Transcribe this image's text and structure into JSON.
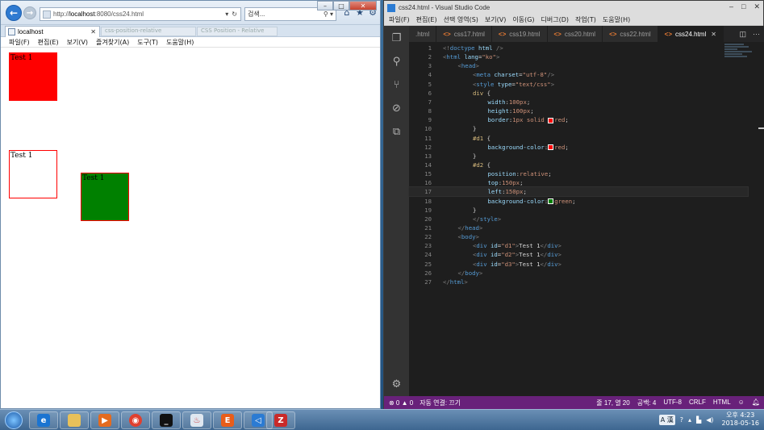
{
  "ie": {
    "address": {
      "prefix": "http://",
      "host": "localhost",
      "path": ":8080/css24.html"
    },
    "search_placeholder": "검색...",
    "tab_title": "localhost",
    "bg_tab_1": "css-position-relative",
    "bg_tab_2": "CSS Position - Relative",
    "menu": [
      "파일(F)",
      "편집(E)",
      "보기(V)",
      "즐겨찾기(A)",
      "도구(T)",
      "도움말(H)"
    ],
    "boxes": [
      {
        "id": "d1",
        "text": "Test 1",
        "background": "#ff0000"
      },
      {
        "id": "d2",
        "text": "Test 1",
        "background": "#ffffff"
      },
      {
        "id": "d3",
        "text": "Test 1",
        "background": "#008000"
      }
    ]
  },
  "vscode": {
    "title": "css24.html - Visual Studio Code",
    "menu": [
      "파일(F)",
      "편집(E)",
      "선택 영역(S)",
      "보기(V)",
      "이동(G)",
      "디버그(D)",
      "작업(T)",
      "도움말(H)"
    ],
    "tabs": [
      {
        "label": ".html",
        "active": false
      },
      {
        "label": "css17.html",
        "active": false
      },
      {
        "label": "css19.html",
        "active": false
      },
      {
        "label": "css20.html",
        "active": false
      },
      {
        "label": "css22.html",
        "active": false
      },
      {
        "label": "css24.html",
        "active": true
      }
    ],
    "code": [
      {
        "n": "1",
        "indent": 0,
        "parts": [
          [
            "punct",
            "<!"
          ],
          [
            "tag",
            "doctype"
          ],
          [
            "attr",
            " html"
          ],
          [
            "punct",
            " />"
          ]
        ]
      },
      {
        "n": "2",
        "indent": 0,
        "parts": [
          [
            "punct",
            "<"
          ],
          [
            "tag",
            "html"
          ],
          [
            "attr",
            " lang"
          ],
          [
            "plain",
            "="
          ],
          [
            "str",
            "\"ko\""
          ],
          [
            "punct",
            ">"
          ]
        ]
      },
      {
        "n": "3",
        "indent": 1,
        "parts": [
          [
            "punct",
            "<"
          ],
          [
            "tag",
            "head"
          ],
          [
            "punct",
            ">"
          ]
        ]
      },
      {
        "n": "4",
        "indent": 2,
        "parts": [
          [
            "punct",
            "<"
          ],
          [
            "tag",
            "meta"
          ],
          [
            "attr",
            " charset"
          ],
          [
            "plain",
            "="
          ],
          [
            "str",
            "\"utf-8\""
          ],
          [
            "punct",
            "/>"
          ]
        ]
      },
      {
        "n": "5",
        "indent": 2,
        "parts": [
          [
            "punct",
            "<"
          ],
          [
            "tag",
            "style"
          ],
          [
            "attr",
            " type"
          ],
          [
            "plain",
            "="
          ],
          [
            "str",
            "\"text/css\""
          ],
          [
            "punct",
            ">"
          ]
        ]
      },
      {
        "n": "6",
        "indent": 2,
        "parts": [
          [
            "sel",
            "div"
          ],
          [
            "plain",
            " {"
          ]
        ]
      },
      {
        "n": "7",
        "indent": 3,
        "parts": [
          [
            "prop",
            "width"
          ],
          [
            "plain",
            ":"
          ],
          [
            "val",
            "100px"
          ],
          [
            "plain",
            ";"
          ]
        ]
      },
      {
        "n": "8",
        "indent": 3,
        "parts": [
          [
            "prop",
            "height"
          ],
          [
            "plain",
            ":"
          ],
          [
            "val",
            "100px"
          ],
          [
            "plain",
            ";"
          ]
        ]
      },
      {
        "n": "9",
        "indent": 3,
        "parts": [
          [
            "prop",
            "border"
          ],
          [
            "plain",
            ":"
          ],
          [
            "val",
            "1px solid "
          ],
          [
            "swatch",
            "#ff0000"
          ],
          [
            "val",
            "red"
          ],
          [
            "plain",
            ";"
          ]
        ]
      },
      {
        "n": "10",
        "indent": 2,
        "parts": [
          [
            "plain",
            "}"
          ]
        ]
      },
      {
        "n": "11",
        "indent": 2,
        "parts": [
          [
            "sel",
            "#d1"
          ],
          [
            "plain",
            " {"
          ]
        ]
      },
      {
        "n": "12",
        "indent": 3,
        "parts": [
          [
            "prop",
            "background-color"
          ],
          [
            "plain",
            ":"
          ],
          [
            "swatch",
            "#ff0000"
          ],
          [
            "val",
            "red"
          ],
          [
            "plain",
            ";"
          ]
        ]
      },
      {
        "n": "13",
        "indent": 2,
        "parts": [
          [
            "plain",
            "}"
          ]
        ]
      },
      {
        "n": "14",
        "indent": 2,
        "parts": [
          [
            "sel",
            "#d2"
          ],
          [
            "plain",
            " {"
          ]
        ]
      },
      {
        "n": "15",
        "indent": 3,
        "parts": [
          [
            "prop",
            "position"
          ],
          [
            "plain",
            ":"
          ],
          [
            "val",
            "relative"
          ],
          [
            "plain",
            ";"
          ]
        ]
      },
      {
        "n": "16",
        "indent": 3,
        "parts": [
          [
            "prop",
            "top"
          ],
          [
            "plain",
            ":"
          ],
          [
            "val",
            "150px"
          ],
          [
            "plain",
            ";"
          ]
        ]
      },
      {
        "n": "17",
        "indent": 3,
        "parts": [
          [
            "prop",
            "left"
          ],
          [
            "plain",
            ":"
          ],
          [
            "val",
            "150px"
          ],
          [
            "plain",
            ";"
          ]
        ]
      },
      {
        "n": "18",
        "indent": 3,
        "parts": [
          [
            "prop",
            "background-color"
          ],
          [
            "plain",
            ":"
          ],
          [
            "swatch",
            "#008000"
          ],
          [
            "val",
            "green"
          ],
          [
            "plain",
            ";"
          ]
        ]
      },
      {
        "n": "19",
        "indent": 2,
        "parts": [
          [
            "plain",
            "}"
          ]
        ]
      },
      {
        "n": "20",
        "indent": 2,
        "parts": [
          [
            "punct",
            "</"
          ],
          [
            "tag",
            "style"
          ],
          [
            "punct",
            ">"
          ]
        ]
      },
      {
        "n": "21",
        "indent": 1,
        "parts": [
          [
            "punct",
            "</"
          ],
          [
            "tag",
            "head"
          ],
          [
            "punct",
            ">"
          ]
        ]
      },
      {
        "n": "22",
        "indent": 1,
        "parts": [
          [
            "punct",
            "<"
          ],
          [
            "tag",
            "body"
          ],
          [
            "punct",
            ">"
          ]
        ]
      },
      {
        "n": "23",
        "indent": 2,
        "parts": [
          [
            "punct",
            "<"
          ],
          [
            "tag",
            "div"
          ],
          [
            "attr",
            " id"
          ],
          [
            "plain",
            "="
          ],
          [
            "str",
            "\"d1\""
          ],
          [
            "punct",
            ">"
          ],
          [
            "plain",
            "Test 1"
          ],
          [
            "punct",
            "</"
          ],
          [
            "tag",
            "div"
          ],
          [
            "punct",
            ">"
          ]
        ]
      },
      {
        "n": "24",
        "indent": 2,
        "parts": [
          [
            "punct",
            "<"
          ],
          [
            "tag",
            "div"
          ],
          [
            "attr",
            " id"
          ],
          [
            "plain",
            "="
          ],
          [
            "str",
            "\"d2\""
          ],
          [
            "punct",
            ">"
          ],
          [
            "plain",
            "Test 1"
          ],
          [
            "punct",
            "</"
          ],
          [
            "tag",
            "div"
          ],
          [
            "punct",
            ">"
          ]
        ]
      },
      {
        "n": "25",
        "indent": 2,
        "parts": [
          [
            "punct",
            "<"
          ],
          [
            "tag",
            "div"
          ],
          [
            "attr",
            " id"
          ],
          [
            "plain",
            "="
          ],
          [
            "str",
            "\"d3\""
          ],
          [
            "punct",
            ">"
          ],
          [
            "plain",
            "Test 1"
          ],
          [
            "punct",
            "</"
          ],
          [
            "tag",
            "div"
          ],
          [
            "punct",
            ">"
          ]
        ]
      },
      {
        "n": "26",
        "indent": 1,
        "parts": [
          [
            "punct",
            "</"
          ],
          [
            "tag",
            "body"
          ],
          [
            "punct",
            ">"
          ]
        ]
      },
      {
        "n": "27",
        "indent": 0,
        "parts": [
          [
            "punct",
            "</"
          ],
          [
            "tag",
            "html"
          ],
          [
            "punct",
            ">"
          ]
        ]
      }
    ],
    "current_line": "17",
    "status": {
      "problems": "⊗ 0 ▲ 0",
      "connection": "자동 연결: 끄기",
      "position": "줄 17, 열 20",
      "spaces": "공백: 4",
      "encoding": "UTF-8",
      "eol": "CRLF",
      "language": "HTML"
    }
  },
  "taskbar": {
    "apps": [
      "ie",
      "explorer",
      "media",
      "chrome",
      "cmd",
      "java",
      "editor",
      "vscode",
      "filezilla"
    ],
    "tray_lang": "A 漢",
    "time": "오후 4:23",
    "date": "2018-05-16"
  },
  "colors": {
    "vs_status": "#68217a",
    "vs_bg": "#1e1e1e",
    "red": "#ff0000",
    "green": "#008000"
  }
}
